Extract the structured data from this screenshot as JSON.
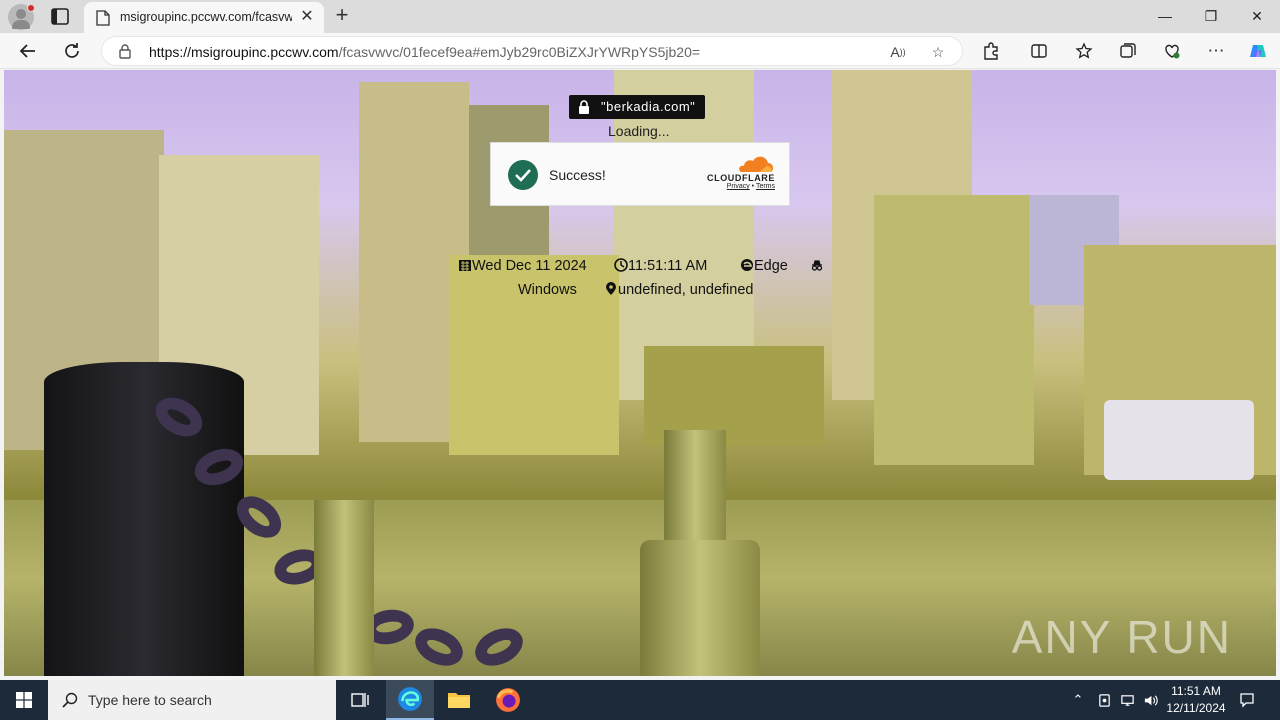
{
  "browser": {
    "tab": {
      "title": "msigroupinc.pccwv.com/fcasvwvc",
      "close": "✕"
    },
    "new_tab": "+",
    "window": {
      "minimize": "—",
      "restore": "❐",
      "close": "✕"
    },
    "address": {
      "host": "https://msigroupinc.pccwv.com",
      "path": "/fcasvwvc/01fecef9ea#emJyb29rc0BiZXJrYWRpYS5jb20="
    }
  },
  "page": {
    "domain_badge": "\"berkadia.com\"",
    "loading": "Loading...",
    "captcha": {
      "status": "Success!",
      "brand": "CLOUDFLARE",
      "privacy": "Privacy",
      "sep": " • ",
      "terms": "Terms"
    },
    "info": {
      "date": "Wed Dec 11 2024",
      "time": "11:51:11 AM",
      "browser": "Edge",
      "os": "Windows",
      "location": "undefined, undefined"
    },
    "watermark": "ANY RUN"
  },
  "taskbar": {
    "search_placeholder": "Type here to search",
    "clock_time": "11:51 AM",
    "clock_date": "12/11/2024"
  }
}
